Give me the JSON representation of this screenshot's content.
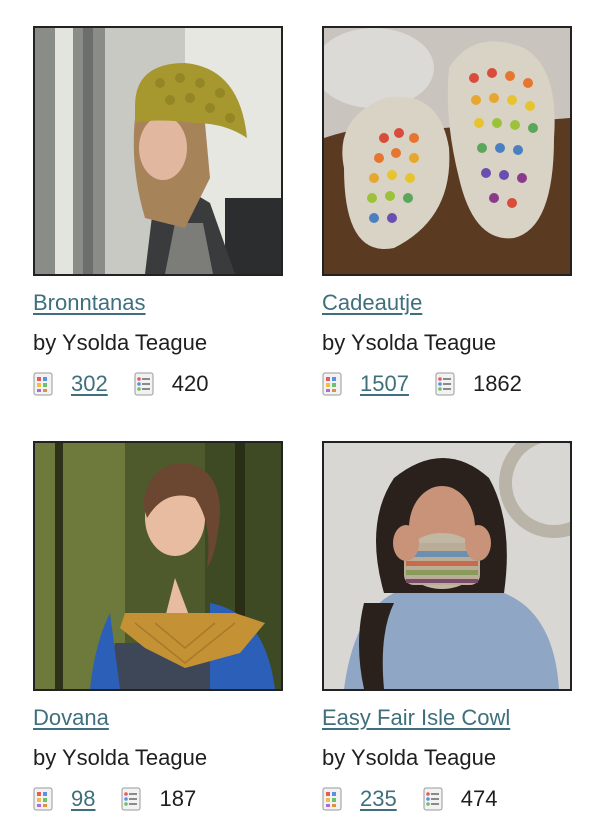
{
  "patterns": [
    {
      "name": "Bronntanas",
      "designer": "by Ysolda Teague",
      "projects": "302",
      "queued": "420",
      "image": "woman-in-mustard-slouch-hat"
    },
    {
      "name": "Cadeautje",
      "designer": "by Ysolda Teague",
      "projects": "1507",
      "queued": "1862",
      "image": "colorful-mosaic-socks"
    },
    {
      "name": "Dovana",
      "designer": "by Ysolda Teague",
      "projects": "98",
      "queued": "187",
      "image": "woman-in-mustard-lace-shawl"
    },
    {
      "name": "Easy Fair Isle Cowl",
      "designer": "by Ysolda Teague",
      "projects": "235",
      "queued": "474",
      "image": "woman-holding-fair-isle-cowl"
    }
  ],
  "icons": {
    "projects": "projects-icon",
    "queued": "queue-list-icon"
  },
  "colors": {
    "link": "#3f6f7c",
    "text": "#1f1f1f"
  }
}
